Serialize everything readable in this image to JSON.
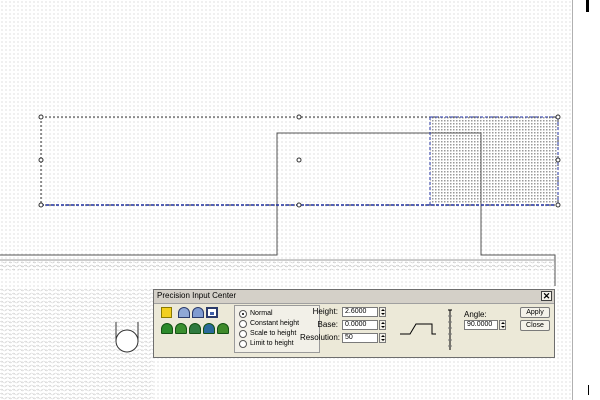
{
  "dialog": {
    "title": "Precision Input Center",
    "close_glyph": "✕",
    "modes": [
      {
        "label": "Normal",
        "selected": true
      },
      {
        "label": "Constant height",
        "selected": false
      },
      {
        "label": "Scale to height",
        "selected": false
      },
      {
        "label": "Limit to height",
        "selected": false
      }
    ],
    "fields": {
      "height": {
        "label": "Height:",
        "value": "2.6000"
      },
      "base": {
        "label": "Base:",
        "value": "0.0000"
      },
      "resolution": {
        "label": "Resolution:",
        "value": "50"
      }
    },
    "angle": {
      "label": "Angle:",
      "value": "90.0000"
    },
    "buttons": {
      "apply": "Apply",
      "close": "Close"
    },
    "tools": [
      "color-swatch-icon",
      "arc-shape-icon",
      "peak-shape-icon",
      "flat-shape-icon",
      "terrain-1-icon",
      "terrain-2-icon",
      "terrain-3-icon",
      "terrain-4-icon",
      "terrain-5-icon"
    ],
    "colors": {
      "swatch": "#f2cf1e",
      "selection": "#1f2fa0"
    }
  }
}
